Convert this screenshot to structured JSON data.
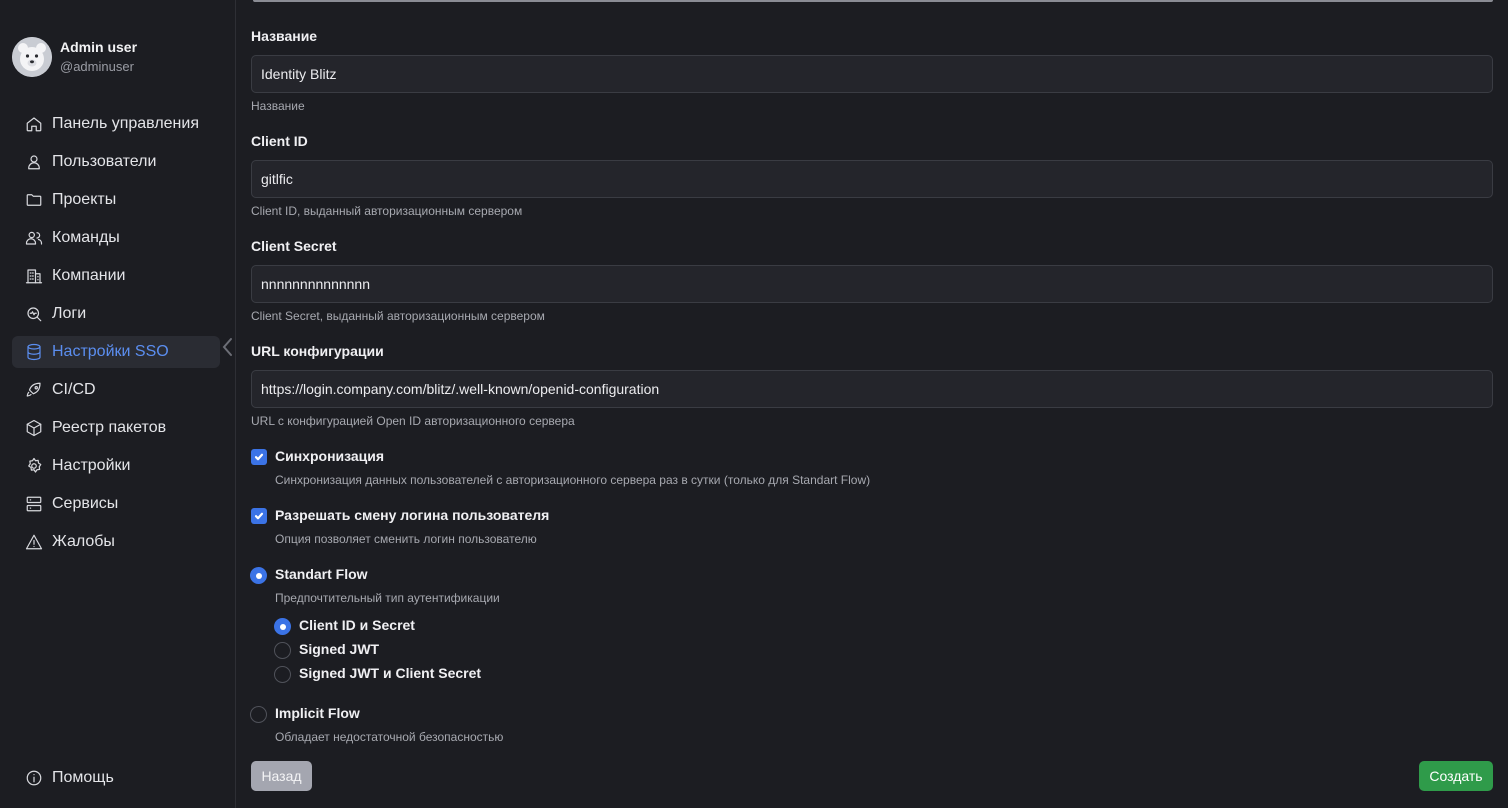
{
  "user": {
    "name": "Admin user",
    "handle": "@adminuser"
  },
  "nav": {
    "items": [
      {
        "label": "Панель управления",
        "icon": "home-icon"
      },
      {
        "label": "Пользователи",
        "icon": "user-icon"
      },
      {
        "label": "Проекты",
        "icon": "folder-icon"
      },
      {
        "label": "Команды",
        "icon": "users-icon"
      },
      {
        "label": "Компании",
        "icon": "building-icon"
      },
      {
        "label": "Логи",
        "icon": "log-search-icon"
      },
      {
        "label": "Настройки SSO",
        "icon": "database-icon",
        "active": true
      },
      {
        "label": "CI/CD",
        "icon": "rocket-icon"
      },
      {
        "label": "Реестр пакетов",
        "icon": "package-icon"
      },
      {
        "label": "Настройки",
        "icon": "gear-icon"
      },
      {
        "label": "Сервисы",
        "icon": "server-icon"
      },
      {
        "label": "Жалобы",
        "icon": "warning-icon"
      }
    ],
    "help": {
      "label": "Помощь",
      "icon": "info-icon"
    }
  },
  "form": {
    "name": {
      "label": "Название",
      "value": "Identity Blitz",
      "hint": "Название"
    },
    "client_id": {
      "label": "Client ID",
      "value": "gitlfic",
      "hint": "Client ID, выданный авторизационным сервером"
    },
    "client_secret": {
      "label": "Client Secret",
      "value": "nnnnnnnnnnnnnn",
      "hint": "Client Secret, выданный авторизационным сервером"
    },
    "config_url": {
      "label": "URL конфигурации",
      "value": "https://login.company.com/blitz/.well-known/openid-configuration",
      "hint": "URL с конфигурацией Open ID авторизационного сервера"
    },
    "sync": {
      "label": "Синхронизация",
      "hint": "Синхронизация данных пользователей с авторизационного сервера раз в сутки (только для Standart Flow)",
      "checked": true
    },
    "allow_login_change": {
      "label": "Разрешать смену логина пользователя",
      "hint": "Опция позволяет сменить логин пользователю",
      "checked": true
    },
    "standart_flow": {
      "label": "Standart Flow",
      "hint": "Предпочтительный тип аутентификации",
      "selected": true,
      "sub_options": [
        {
          "label": "Client ID и Secret",
          "selected": true
        },
        {
          "label": "Signed JWT",
          "selected": false
        },
        {
          "label": "Signed JWT и Client Secret",
          "selected": false
        }
      ]
    },
    "implicit_flow": {
      "label": "Implicit Flow",
      "hint": "Обладает недостаточной безопасностью",
      "selected": false
    }
  },
  "actions": {
    "back": "Назад",
    "create": "Создать"
  },
  "colors": {
    "accent": "#3b73e6",
    "active_nav": "#5b8ef0",
    "create_button": "#2f9b4a",
    "back_button": "#a4a6b0"
  }
}
